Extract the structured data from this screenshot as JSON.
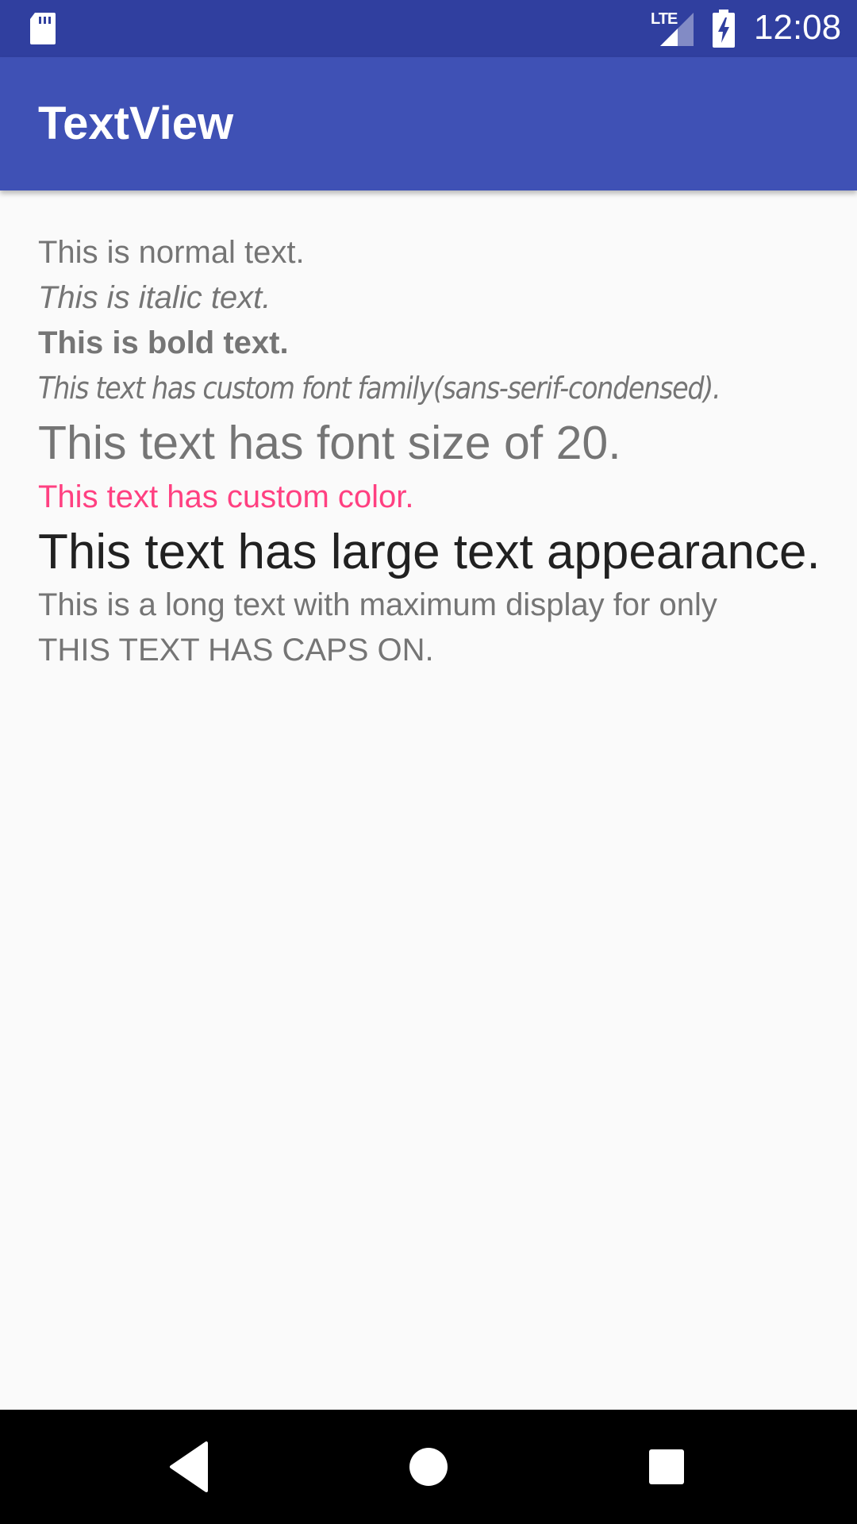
{
  "status_bar": {
    "time": "12:08",
    "network_label": "LTE",
    "icons": [
      "sd-card-icon",
      "lte-signal-icon",
      "battery-charging-icon"
    ],
    "color": "#303f9f"
  },
  "app_bar": {
    "title": "TextView",
    "color": "#3f51b5"
  },
  "text_views": {
    "normal": "This is normal text.",
    "italic": "This is italic text.",
    "bold": "This is bold text.",
    "custom_font": "This text has custom font family(sans-serif-condensed).",
    "font_size": "This text has font size of 20.",
    "custom_color": "This text has custom color.",
    "large_appearance": "This text has large text appearance.",
    "long_text": "This is a long text with maximum display for only",
    "caps": "THIS TEXT HAS CAPS ON."
  },
  "colors": {
    "secondary_text": "#757575",
    "accent": "#ff4081",
    "primary_text": "#212121",
    "background": "#fafafa"
  },
  "nav_bar": {
    "buttons": [
      "back-icon",
      "home-icon",
      "recents-icon"
    ]
  }
}
